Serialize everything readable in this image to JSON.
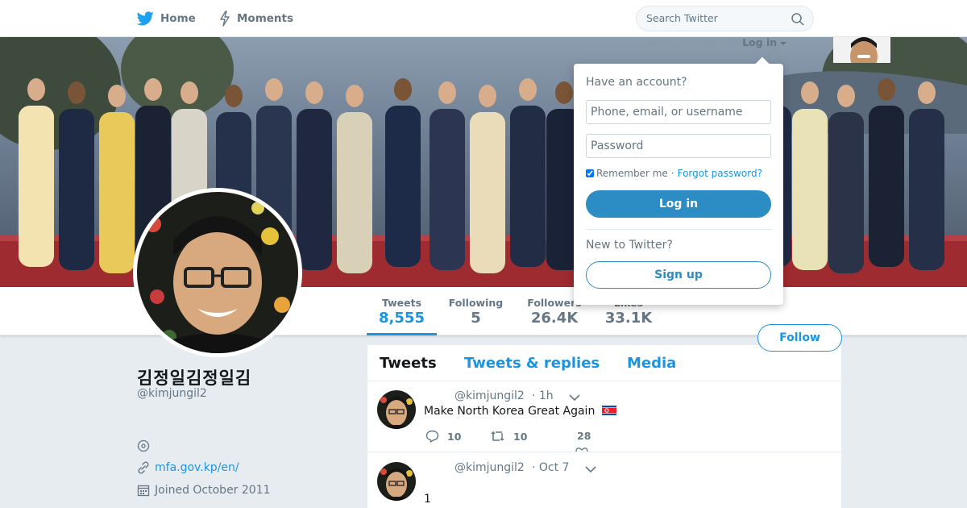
{
  "nav": {
    "home_label": "Home",
    "moments_label": "Moments",
    "search_placeholder": "Search Twitter"
  },
  "login_strip": {
    "question": "Have an account?",
    "login_label": "Log in"
  },
  "login_dropdown": {
    "title": "Have an account?",
    "username_placeholder": "Phone, email, or username",
    "password_placeholder": "Password",
    "remember_label": "Remember me",
    "separator": "·",
    "forgot_label": "Forgot password?",
    "login_button": "Log in",
    "new_title": "New to Twitter?",
    "signup_button": "Sign up"
  },
  "profile": {
    "name": "김정일김정일김",
    "handle": "@kimjungil2",
    "website": "mfa.gov.kp/en/",
    "joined": "Joined October 2011"
  },
  "stats": [
    {
      "label": "Tweets",
      "value": "8,555"
    },
    {
      "label": "Following",
      "value": "5"
    },
    {
      "label": "Followers",
      "value": "26.4K"
    },
    {
      "label": "Likes",
      "value": "33.1K"
    }
  ],
  "follow_label": "Follow",
  "timeline": {
    "tabs": [
      "Tweets",
      "Tweets & replies",
      "Media"
    ],
    "tweets": [
      {
        "handle": "@kimjungil2",
        "time": "· 1h",
        "text": "Make North Korea Great Again",
        "replies": "10",
        "retweets": "10",
        "likes": "28"
      },
      {
        "handle": "@kimjungil2",
        "time": "· Oct 7",
        "text": "1"
      }
    ]
  },
  "colors": {
    "accent": "#1b95e0",
    "button": "#2b8dc4",
    "background": "#e6ecf0"
  }
}
